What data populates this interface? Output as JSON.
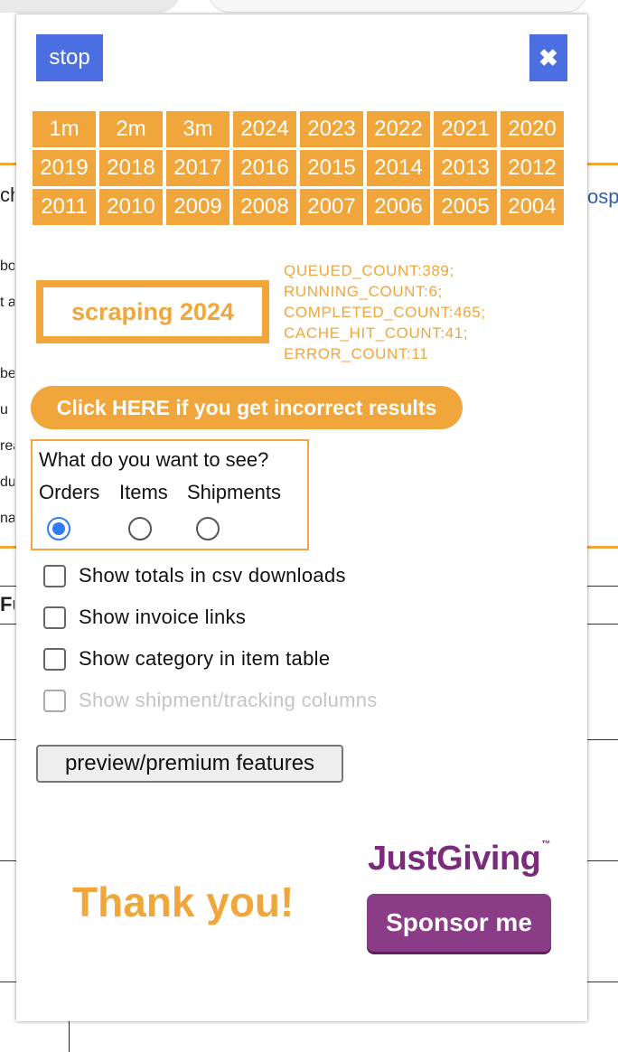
{
  "background_page": {
    "fragments": [
      {
        "text": "ch",
        "bold": false
      },
      {
        "text": "ospi",
        "bold": false
      },
      {
        "text": "bou",
        "bold": false
      },
      {
        "text": "t a",
        "bold": false
      },
      {
        "text": "be",
        "bold": false
      },
      {
        "text": "u",
        "bold": false
      },
      {
        "text": "rea",
        "bold": false
      },
      {
        "text": "du",
        "bold": false
      },
      {
        "text": "nar",
        "bold": false
      },
      {
        "text": "Fu",
        "bold": true
      }
    ]
  },
  "popup": {
    "stop_label": "stop",
    "close_icon": "close-icon",
    "close_glyph": "✖",
    "date_ranges": [
      "1m",
      "2m",
      "3m",
      "2024",
      "2023",
      "2022",
      "2021",
      "2020",
      "2019",
      "2018",
      "2017",
      "2016",
      "2015",
      "2014",
      "2013",
      "2012",
      "2011",
      "2010",
      "2009",
      "2008",
      "2007",
      "2006",
      "2005",
      "2004"
    ],
    "scraping_status": "scraping 2024",
    "stats": [
      "QUEUED_COUNT:389;",
      "RUNNING_COUNT:6;",
      "COMPLETED_COUNT:465;",
      "CACHE_HIT_COUNT:41;",
      "ERROR_COUNT:11"
    ],
    "incorrect_results_label": "Click HERE if you get incorrect results",
    "view_selector": {
      "question": "What do you want to see?",
      "options": [
        "Orders",
        "Items",
        "Shipments"
      ],
      "selected": "Orders"
    },
    "checkboxes": [
      {
        "label": "Show totals in csv downloads",
        "checked": false,
        "disabled": false
      },
      {
        "label": "Show invoice links",
        "checked": false,
        "disabled": false
      },
      {
        "label": "Show category in item table",
        "checked": false,
        "disabled": false
      },
      {
        "label": "Show shipment/tracking columns",
        "checked": false,
        "disabled": true
      }
    ],
    "premium_label": "preview/premium features",
    "thank_you": "Thank you!",
    "justgiving": {
      "logo_text": "JustGiving",
      "trademark": "™",
      "sponsor_label": "Sponsor me"
    }
  },
  "colors": {
    "accent_orange": "#f0a63a",
    "button_blue": "#4b6ee0",
    "radio_blue": "#2f7cf6",
    "justgiving_purple": "#7a2b7b"
  }
}
